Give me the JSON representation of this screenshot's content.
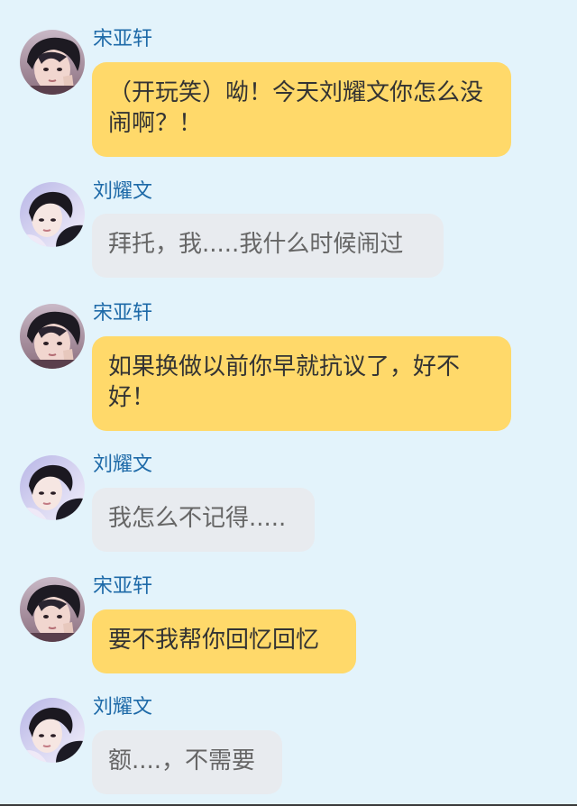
{
  "colors": {
    "background": "#e3f3fb",
    "name_text": "#1e6aa8",
    "bubble_yellow": "#ffd96a",
    "bubble_gray": "#e8ebef"
  },
  "messages": [
    {
      "sender": "宋亚轩",
      "text": "（开玩笑）呦！今天刘耀文你怎么没闹啊？！",
      "bubble_color": "yellow",
      "avatar": "avatar-song-yaxuan"
    },
    {
      "sender": "刘耀文",
      "text": "拜托，我.....我什么时候闹过",
      "bubble_color": "gray",
      "avatar": "avatar-liu-yaowen"
    },
    {
      "sender": "宋亚轩",
      "text": "如果换做以前你早就抗议了，好不好！",
      "bubble_color": "yellow",
      "avatar": "avatar-song-yaxuan"
    },
    {
      "sender": "刘耀文",
      "text": "我怎么不记得.....",
      "bubble_color": "gray",
      "avatar": "avatar-liu-yaowen"
    },
    {
      "sender": "宋亚轩",
      "text": "要不我帮你回忆回忆",
      "bubble_color": "yellow",
      "avatar": "avatar-song-yaxuan"
    },
    {
      "sender": "刘耀文",
      "text": "额....，不需要",
      "bubble_color": "gray",
      "avatar": "avatar-liu-yaowen"
    }
  ]
}
